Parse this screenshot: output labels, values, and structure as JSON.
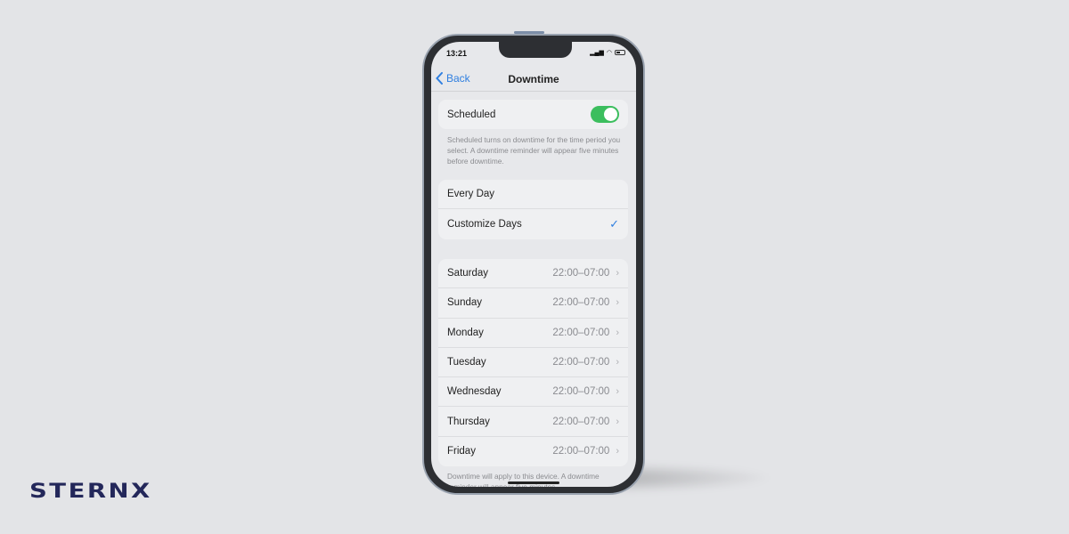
{
  "status": {
    "time": "13:21",
    "signal_icon": "signal-icon",
    "wifi_icon": "wifi-icon",
    "battery_icon": "battery-icon"
  },
  "nav": {
    "back_label": "Back",
    "title": "Downtime"
  },
  "scheduled": {
    "label": "Scheduled",
    "enabled": true,
    "footer": "Scheduled turns on downtime for the time period you select. A downtime reminder will appear five minutes before downtime."
  },
  "days_mode": {
    "options": [
      {
        "label": "Every Day",
        "selected": false
      },
      {
        "label": "Customize Days",
        "selected": true
      }
    ]
  },
  "days": [
    {
      "day": "Saturday",
      "time": "22:00–07:00"
    },
    {
      "day": "Sunday",
      "time": "22:00–07:00"
    },
    {
      "day": "Monday",
      "time": "22:00–07:00"
    },
    {
      "day": "Tuesday",
      "time": "22:00–07:00"
    },
    {
      "day": "Wednesday",
      "time": "22:00–07:00"
    },
    {
      "day": "Thursday",
      "time": "22:00–07:00"
    },
    {
      "day": "Friday",
      "time": "22:00–07:00"
    }
  ],
  "bottom_footer": "Downtime will apply to this device. A downtime reminder will appear five minutes",
  "brand": {
    "logo": "STERNX",
    "color": "#23275a"
  },
  "colors": {
    "accent": "#2f7fe0",
    "toggle_on": "#3cbe5e"
  }
}
